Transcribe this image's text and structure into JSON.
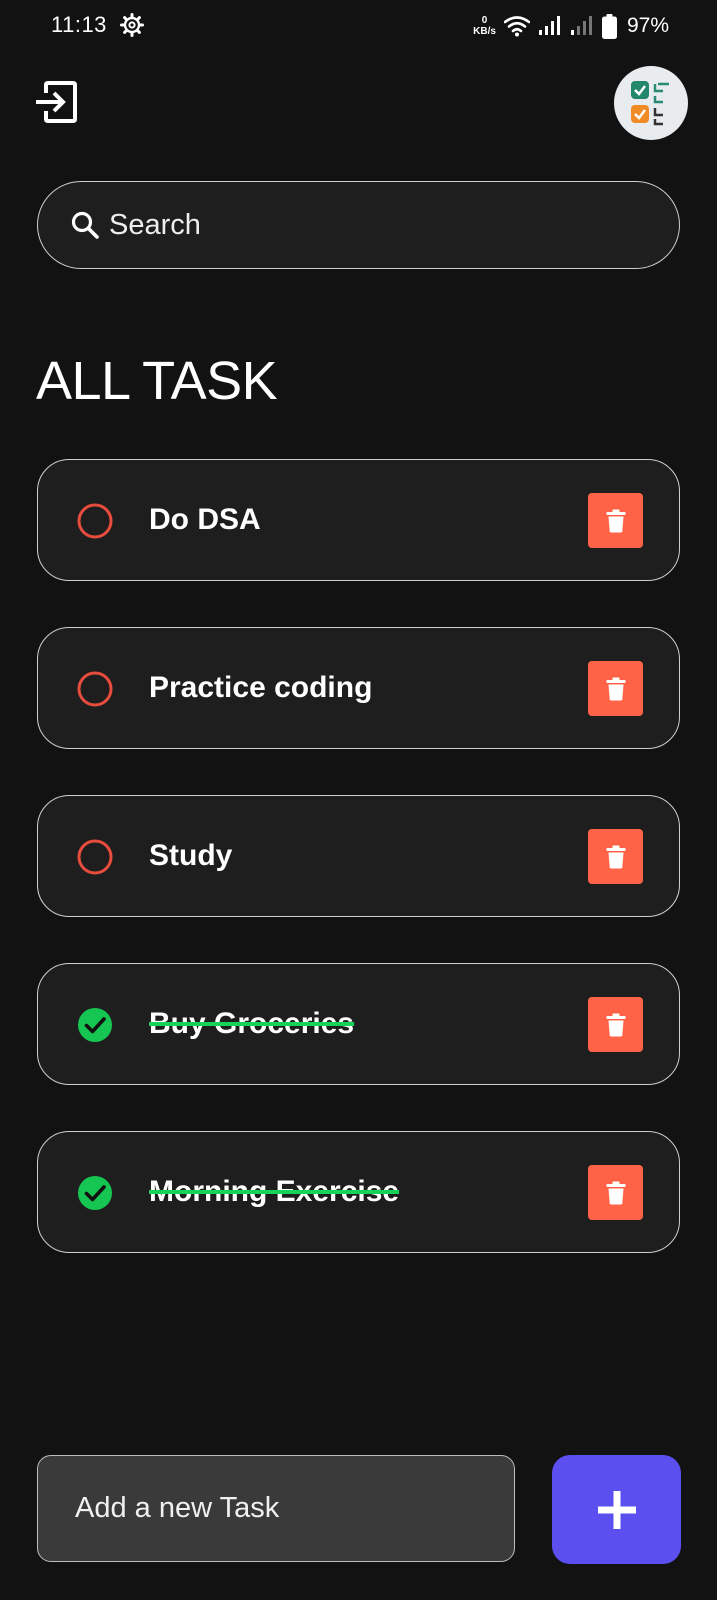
{
  "status_bar": {
    "time": "11:13",
    "net_speed_value": "0",
    "net_speed_unit": "KB/s",
    "battery": "97%",
    "icons": [
      "settings-gear-icon",
      "wifi-icon",
      "signal-icon",
      "signal-weak-icon",
      "battery-icon"
    ]
  },
  "header": {
    "logout_icon": "logout-icon",
    "avatar_icon": "checklist-app-icon"
  },
  "search": {
    "placeholder": "Search",
    "icon": "search-icon"
  },
  "section": {
    "title": "ALL TASK"
  },
  "tasks": [
    {
      "title": "Do DSA",
      "done": false
    },
    {
      "title": "Practice coding",
      "done": false
    },
    {
      "title": "Study",
      "done": false
    },
    {
      "title": "Buy Groceries",
      "done": true
    },
    {
      "title": "Morning Exercise",
      "done": true
    }
  ],
  "add_task": {
    "placeholder": "Add a new Task",
    "button_icon": "plus-icon"
  },
  "colors": {
    "background": "#121212",
    "card": "#1e1e1e",
    "pending_circle": "#e84c3d",
    "done_check": "#16c652",
    "strike": "#16d25a",
    "delete": "#ff6347",
    "add_button": "#5b4ff0",
    "input_bg": "#3a3a3a"
  }
}
